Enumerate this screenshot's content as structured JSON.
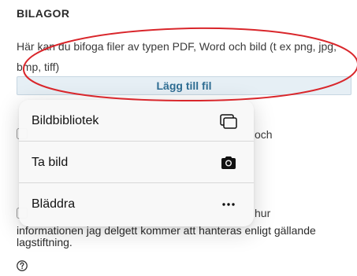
{
  "attachments": {
    "title": "BILAGOR",
    "description": "Här kan du bifoga filer av typen PDF, Word och bild (t ex png, jpg, bmp, tiff)",
    "add_file_label": "Lägg till fil"
  },
  "background": {
    "partial_text_1": "och",
    "partial_text_2": "hur",
    "consent_text": "informationen jag delgett kommer att hanteras enligt gällande lagstiftning."
  },
  "menu": {
    "items": [
      {
        "label": "Bildbibliotek",
        "icon": "photo-library-icon"
      },
      {
        "label": "Ta bild",
        "icon": "camera-icon"
      },
      {
        "label": "Bläddra",
        "icon": "more-icon"
      }
    ]
  },
  "annotation": {
    "color": "#d9262b"
  },
  "help": {
    "icon": "help-icon"
  }
}
